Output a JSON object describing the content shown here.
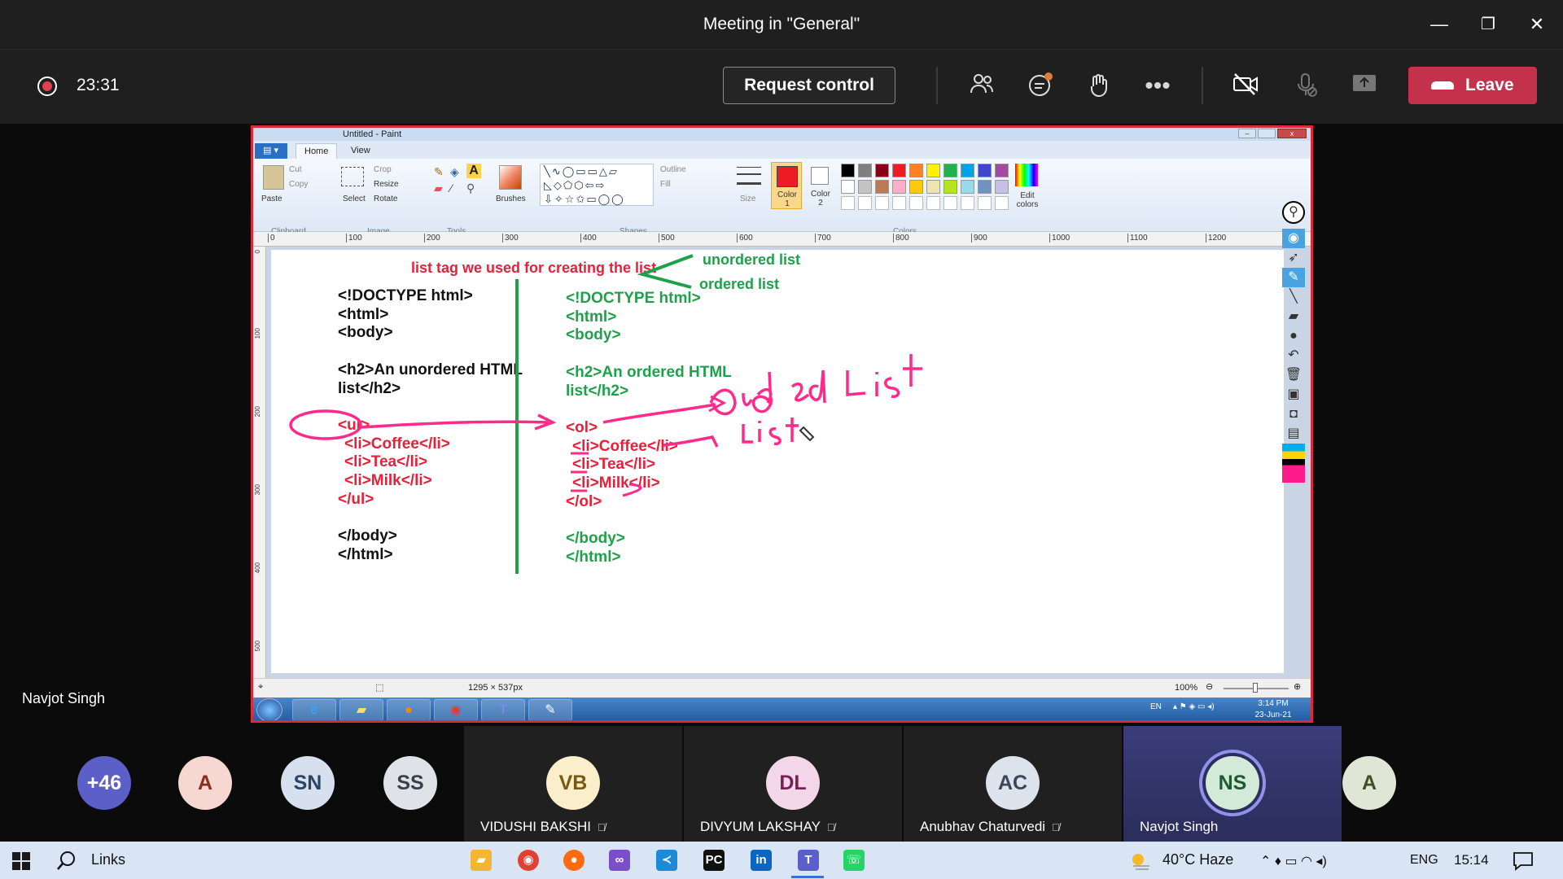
{
  "window": {
    "title": "Meeting in \"General\"",
    "minimize": "—",
    "restore": "❐",
    "close": "✕"
  },
  "toolbar": {
    "timer": "23:31",
    "request_control": "Request control",
    "leave": "Leave",
    "icons": [
      "people-icon",
      "chat-icon",
      "raise-hand-icon",
      "more-icon",
      "camera-off-icon",
      "mic-off-icon",
      "share-icon"
    ]
  },
  "paint": {
    "title": "Untitled - Paint",
    "tabs": [
      "Home",
      "View"
    ],
    "clipboard": {
      "paste": "Paste",
      "cut": "Cut",
      "copy": "Copy",
      "group": "Clipboard"
    },
    "image": {
      "select": "Select",
      "crop": "Crop",
      "resize": "Resize",
      "rotate": "Rotate",
      "group": "Image"
    },
    "tools_group": "Tools",
    "brushes": "Brushes",
    "shapes": {
      "outline": "Outline",
      "fill": "Fill",
      "group": "Shapes"
    },
    "size": "Size",
    "color1": "Color 1",
    "color2": "Color 2",
    "colors_group": "Colors",
    "edit_colors": "Edit colors",
    "palette": [
      "#000000",
      "#7f7f7f",
      "#880015",
      "#ed1c24",
      "#ff7f27",
      "#fff200",
      "#22b14c",
      "#00a2e8",
      "#3f48cc",
      "#a349a4",
      "#ffffff",
      "#c3c3c3",
      "#b97a57",
      "#ffaec9",
      "#ffc90e",
      "#efe4b0",
      "#b5e61d",
      "#99d9ea",
      "#7092be",
      "#c8bfe7"
    ],
    "ruler_ticks": [
      "0",
      "100",
      "200",
      "300",
      "400",
      "500",
      "600",
      "700",
      "800",
      "900",
      "1000",
      "1100",
      "1200"
    ],
    "vruler_ticks": [
      "0",
      "100",
      "200",
      "300",
      "400",
      "500"
    ],
    "status_size": "1295 × 537px",
    "zoom": "100%",
    "canvas": {
      "heading": "list tag we used for creating the list",
      "unordered": "unordered list",
      "ordered": "ordered list",
      "left_code": [
        "<!DOCTYPE html>",
        "<html>",
        "<body>",
        "",
        "<h2>An unordered HTML",
        "list</h2>",
        "",
        "<ul>",
        "  <li>Coffee</li>",
        "  <li>Tea</li>",
        "  <li>Milk</li>",
        "</ul>",
        "",
        "</body>",
        "</html>"
      ],
      "right_code": [
        "<!DOCTYPE html>",
        "<html>",
        "<body>",
        "",
        "<h2>An ordered HTML",
        "list</h2>",
        "",
        "<ol>",
        "  <li>Coffee</li>",
        "  <li>Tea</li>",
        "  <li>Milk</li>",
        "</ol>",
        "",
        "</body>",
        "</html>"
      ]
    },
    "win7": {
      "lang": "EN",
      "time": "3:14 PM",
      "date": "23-Jun-21"
    }
  },
  "presenter_name": "Navjot Singh",
  "participants": [
    {
      "initials": "+46",
      "name": "",
      "bg": "#5b5fc7",
      "fg": "#ffffff"
    },
    {
      "initials": "A",
      "name": "",
      "bg": "#f6d7d2",
      "fg": "#8a2b1f"
    },
    {
      "initials": "SN",
      "name": "",
      "bg": "#d6e0ee",
      "fg": "#2c4566"
    },
    {
      "initials": "SS",
      "name": "",
      "bg": "#dfe3e8",
      "fg": "#38424f"
    },
    {
      "initials": "VB",
      "name": "VIDUSHI BAKSHI",
      "bg": "#fbeecb",
      "fg": "#7a5a10"
    },
    {
      "initials": "DL",
      "name": "DIVYUM LAKSHAY",
      "bg": "#f3d6e8",
      "fg": "#7a1f56"
    },
    {
      "initials": "AC",
      "name": "Anubhav Chaturvedi",
      "bg": "#dde3ec",
      "fg": "#3b4658"
    },
    {
      "initials": "NS",
      "name": "Navjot Singh",
      "bg": "#d3ead9",
      "fg": "#1f5a32"
    },
    {
      "initials": "A",
      "name": "",
      "bg": "#dfe6d5",
      "fg": "#3e5028"
    }
  ],
  "taskbar": {
    "search": "Links",
    "weather": "40°C  Haze",
    "lang": "ENG",
    "time": "15:14"
  }
}
